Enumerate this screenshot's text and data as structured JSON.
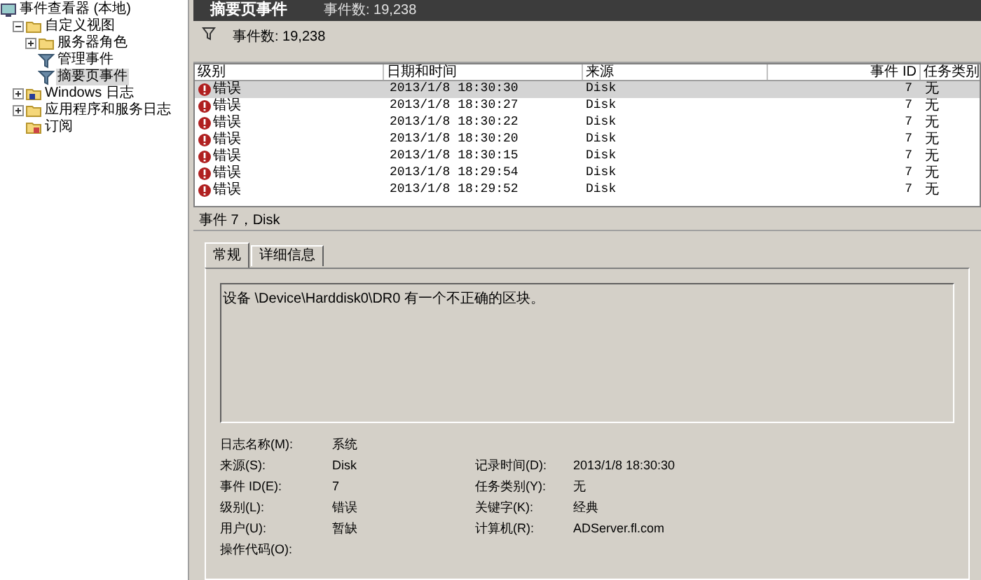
{
  "tree": [
    {
      "label": "事件查看器 (本地)",
      "kind": "root",
      "selected": false,
      "children": [
        {
          "label": "自定义视图",
          "kind": "folder",
          "expanded": true,
          "selected": false,
          "children": [
            {
              "label": "服务器角色",
              "kind": "folder",
              "expanded": false,
              "selected": false
            },
            {
              "label": "管理事件",
              "kind": "filter",
              "selected": false
            },
            {
              "label": "摘要页事件",
              "kind": "filter",
              "selected": true
            }
          ]
        },
        {
          "label": "Windows 日志",
          "kind": "log",
          "expanded": false,
          "selected": false
        },
        {
          "label": "应用程序和服务日志",
          "kind": "folder",
          "expanded": false,
          "selected": false
        },
        {
          "label": "订阅",
          "kind": "subscription",
          "selected": false
        }
      ]
    }
  ],
  "header": {
    "title": "摘要页事件",
    "count": "事件数: 19,238"
  },
  "filter_bar": {
    "count": "事件数: 19,238"
  },
  "table": {
    "columns": [
      "级别",
      "日期和时间",
      "来源",
      "事件 ID",
      "任务类别"
    ],
    "rows": [
      {
        "level": "错误",
        "time": "2013/1/8 18:30:30",
        "source": "Disk",
        "id": "7",
        "task": "无",
        "selected": true
      },
      {
        "level": "错误",
        "time": "2013/1/8 18:30:27",
        "source": "Disk",
        "id": "7",
        "task": "无",
        "selected": false
      },
      {
        "level": "错误",
        "time": "2013/1/8 18:30:22",
        "source": "Disk",
        "id": "7",
        "task": "无",
        "selected": false
      },
      {
        "level": "错误",
        "time": "2013/1/8 18:30:20",
        "source": "Disk",
        "id": "7",
        "task": "无",
        "selected": false
      },
      {
        "level": "错误",
        "time": "2013/1/8 18:30:15",
        "source": "Disk",
        "id": "7",
        "task": "无",
        "selected": false
      },
      {
        "level": "错误",
        "time": "2013/1/8 18:29:54",
        "source": "Disk",
        "id": "7",
        "task": "无",
        "selected": false
      },
      {
        "level": "错误",
        "time": "2013/1/8 18:29:52",
        "source": "Disk",
        "id": "7",
        "task": "无",
        "selected": false
      }
    ]
  },
  "detail": {
    "title": "事件 7，Disk",
    "tabs": [
      {
        "label": "常规",
        "selected": true
      },
      {
        "label": "详细信息",
        "selected": false
      }
    ],
    "message": "设备 \\Device\\Harddisk0\\DR0 有一个不正确的区块。",
    "properties": [
      [
        {
          "label": "日志名称(M):",
          "value": "系统"
        }
      ],
      [
        {
          "label": "来源(S):",
          "value": "Disk"
        },
        {
          "label": "记录时间(D):",
          "value": "2013/1/8 18:30:30"
        }
      ],
      [
        {
          "label": "事件 ID(E):",
          "value": "7"
        },
        {
          "label": "任务类别(Y):",
          "value": "无"
        }
      ],
      [
        {
          "label": "级别(L):",
          "value": "错误"
        },
        {
          "label": "关键字(K):",
          "value": "经典"
        }
      ],
      [
        {
          "label": "用户(U):",
          "value": "暂缺"
        },
        {
          "label": "计算机(R):",
          "value": "ADServer.fl.com"
        }
      ],
      [
        {
          "label": "操作代码(O):"
        }
      ]
    ]
  }
}
